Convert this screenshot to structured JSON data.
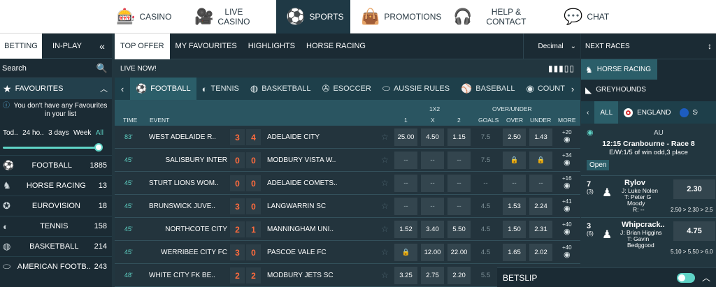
{
  "topnav": [
    {
      "label": "CASINO",
      "icon": "slot-machine-icon"
    },
    {
      "label": "LIVE\nCASINO",
      "icon": "camera-icon"
    },
    {
      "label": "SPORTS",
      "icon": "soccer-ball-icon"
    },
    {
      "label": "PROMOTIONS",
      "icon": "shopping-bag-icon"
    },
    {
      "label": "HELP &\nCONTACT",
      "icon": "headset-icon"
    },
    {
      "label": "CHAT",
      "icon": "chat-bubble-icon"
    }
  ],
  "left": {
    "tabs": [
      "BETTING",
      "IN-PLAY"
    ],
    "collapse": "«",
    "search_label": "Search",
    "favourites_label": "FAVOURITES",
    "favourites_info": "You don't have any Favourites in your list",
    "periods": [
      "Tod..",
      "24 ho..",
      "3 days",
      "Week",
      "All"
    ],
    "sports": [
      {
        "name": "FOOTBALL",
        "count": "1885",
        "icon": "football-icon"
      },
      {
        "name": "HORSE RACING",
        "count": "13",
        "icon": "horse-icon"
      },
      {
        "name": "EUROVISION",
        "count": "18",
        "icon": "star-icon"
      },
      {
        "name": "TENNIS",
        "count": "158",
        "icon": "tennis-ball-icon"
      },
      {
        "name": "BASKETBALL",
        "count": "214",
        "icon": "basketball-icon"
      },
      {
        "name": "AMERICAN FOOTB..",
        "count": "243",
        "icon": "american-football-icon"
      }
    ]
  },
  "center": {
    "tabs": [
      "TOP OFFER",
      "MY FAVOURITES",
      "HIGHLIGHTS",
      "HORSE RACING"
    ],
    "odds_format": "Decimal",
    "live_label": "LIVE NOW!",
    "sport_tabs": [
      {
        "label": "FOOTBALL",
        "icon": "football-icon"
      },
      {
        "label": "TENNIS",
        "icon": "tennis-ball-icon"
      },
      {
        "label": "BASKETBALL",
        "icon": "basketball-icon"
      },
      {
        "label": "ESOCCER",
        "icon": "esoccer-icon"
      },
      {
        "label": "AUSSIE RULES",
        "icon": "aussie-rules-icon"
      },
      {
        "label": "BASEBALL",
        "icon": "baseball-icon"
      },
      {
        "label": "COUNTER-STRIKE",
        "icon": "counter-strike-icon"
      }
    ],
    "header": {
      "time": "TIME",
      "event": "EVENT",
      "group1": "1X2",
      "group2": "OVER/UNDER",
      "c1": "1",
      "cx": "X",
      "c2": "2",
      "goals": "GOALS",
      "over": "OVER",
      "under": "UNDER",
      "more": "MORE"
    },
    "rows": [
      {
        "time": "83'",
        "home": "WEST ADELAIDE R..",
        "hs": "3",
        "as": "4",
        "away": "ADELAIDE CITY",
        "o1": "25.00",
        "ox": "4.50",
        "o2": "1.15",
        "goals": "7.5",
        "over": "2.50",
        "under": "1.43",
        "more": "+20"
      },
      {
        "time": "45'",
        "home": "SALISBURY INTER",
        "hs": "0",
        "as": "0",
        "away": "MODBURY VISTA W..",
        "o1": "--",
        "ox": "--",
        "o2": "--",
        "goals": "7.5",
        "over": "🔒",
        "under": "🔒",
        "more": "+34"
      },
      {
        "time": "45'",
        "home": "STURT LIONS WOM..",
        "hs": "0",
        "as": "0",
        "away": "ADELAIDE COMETS..",
        "o1": "--",
        "ox": "--",
        "o2": "--",
        "goals": "--",
        "over": "--",
        "under": "--",
        "more": "+16"
      },
      {
        "time": "45'",
        "home": "BRUNSWICK JUVE..",
        "hs": "3",
        "as": "0",
        "away": "LANGWARRIN SC",
        "o1": "--",
        "ox": "--",
        "o2": "--",
        "goals": "4.5",
        "over": "1.53",
        "under": "2.24",
        "more": "+41"
      },
      {
        "time": "45'",
        "home": "NORTHCOTE CITY",
        "hs": "2",
        "as": "1",
        "away": "MANNINGHAM UNI..",
        "o1": "1.52",
        "ox": "3.40",
        "o2": "5.50",
        "goals": "4.5",
        "over": "1.50",
        "under": "2.31",
        "more": "+40"
      },
      {
        "time": "45'",
        "home": "WERRIBEE CITY FC",
        "hs": "3",
        "as": "0",
        "away": "PASCOE VALE FC",
        "o1": "🔒",
        "ox": "12.00",
        "o2": "22.00",
        "goals": "4.5",
        "over": "1.65",
        "under": "2.02",
        "more": "+40"
      },
      {
        "time": "48'",
        "home": "WHITE CITY FK BE..",
        "hs": "2",
        "as": "2",
        "away": "MODBURY JETS SC",
        "o1": "3.25",
        "ox": "2.75",
        "o2": "2.20",
        "goals": "5.5",
        "over": "",
        "under": "",
        "more": ""
      }
    ]
  },
  "right": {
    "title": "NEXT RACES",
    "types": [
      "HORSE RACING",
      "GREYHOUNDS"
    ],
    "countries": [
      "ALL",
      "ENGLAND",
      "SC"
    ],
    "region": "AU",
    "race_title": "12:15 Cranbourne - Race 8",
    "race_terms": "E/W:1/5 of win odd,3 place",
    "status": "Open",
    "runners": [
      {
        "num": "7",
        "draw": "(3)",
        "name": "Rylov",
        "jockey": "J: Luke Nolen",
        "trainer": "T: Peter G",
        "trainer2": "Moody",
        "rating": "R: --",
        "odds": "2.30",
        "history": "2.50 > 2.30 > 2.5"
      },
      {
        "num": "3",
        "draw": "(6)",
        "name": "Whipcrack..",
        "jockey": "J: Brian Higgins",
        "trainer": "T: Gavin",
        "trainer2": "Bedggood",
        "rating": "R: --",
        "odds": "4.75",
        "history": "5.10 > 5.50 > 6.0"
      }
    ]
  },
  "betslip": {
    "label": "BETSLIP"
  }
}
